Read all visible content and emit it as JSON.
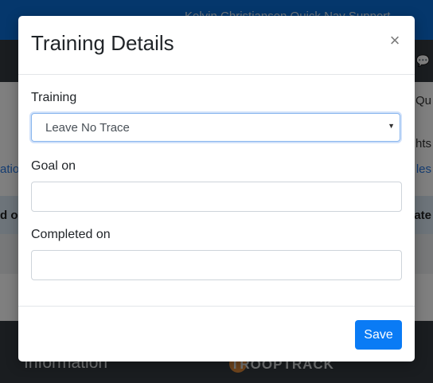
{
  "background": {
    "topbar_text": "Kelvin Christiansen   Quick Nav   Support",
    "side_right_1": "Qu",
    "side_right_2": "ghts",
    "link_left": "atio",
    "link_right": "les",
    "table_head_left": "d o",
    "table_head_right": "ate",
    "footer_title": "Information",
    "footer_logo": "TROOPTRACK"
  },
  "modal": {
    "title": "Training Details",
    "close_glyph": "×",
    "training": {
      "label": "Training",
      "selected": "Leave No Trace"
    },
    "goal_on": {
      "label": "Goal on",
      "value": ""
    },
    "completed_on": {
      "label": "Completed on",
      "value": ""
    },
    "save_label": "Save"
  },
  "colors": {
    "primary": "#0a7bf5",
    "backdrop": "rgba(0,0,0,0.5)"
  }
}
